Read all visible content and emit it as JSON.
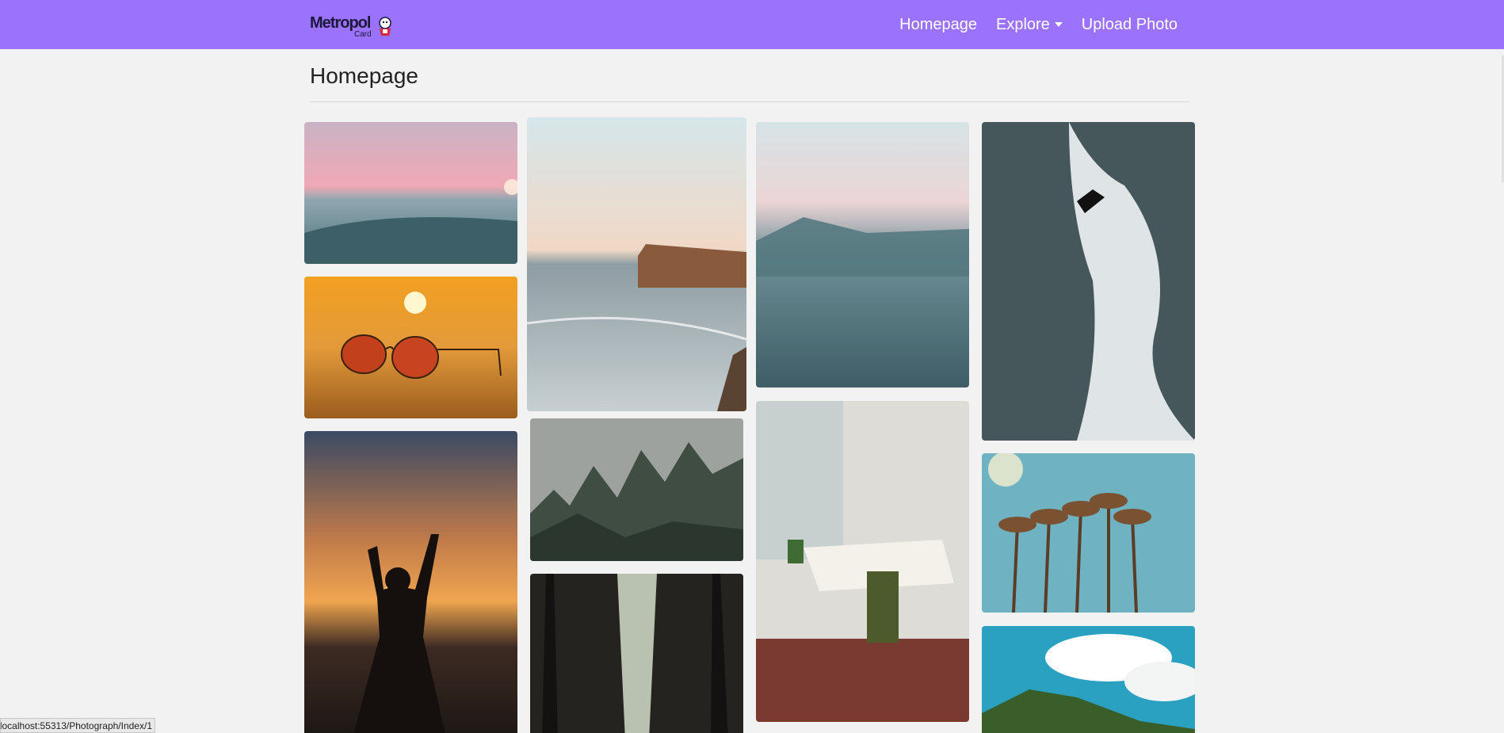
{
  "navbar": {
    "brand_name": "Metropol",
    "brand_sub": "Card",
    "color": "#9a72fb",
    "links": [
      {
        "label": "Homepage"
      },
      {
        "label": "Explore",
        "has_dropdown": true
      },
      {
        "label": "Upload Photo"
      }
    ]
  },
  "page": {
    "title": "Homepage"
  },
  "gallery": {
    "photos": [
      {
        "subject": "pink sunset over surfers in the sea"
      },
      {
        "subject": "orange aviator sunglasses on sand at sunset"
      },
      {
        "subject": "person splashing water at sunset"
      },
      {
        "subject": "sea cliff and rocky shore"
      },
      {
        "subject": "misty pine forest"
      },
      {
        "subject": "dark forest path between tall trees"
      },
      {
        "subject": "misty sea horizon"
      },
      {
        "subject": "drafting desk by a window"
      },
      {
        "subject": "surfer riding a breaking wave"
      },
      {
        "subject": "palm trees against blue sky"
      },
      {
        "subject": "green hill under cloudy blue sky"
      }
    ]
  },
  "status_bar": {
    "url": "localhost:55313/Photograph/Index/1"
  }
}
